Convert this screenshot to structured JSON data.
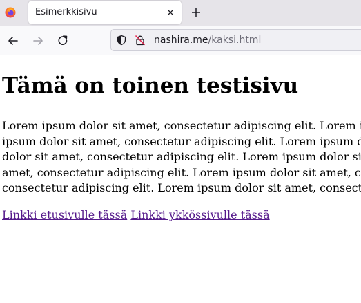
{
  "browser": {
    "tab": {
      "title": "Esimerkkisivu"
    },
    "address": {
      "domain": "nashira.me",
      "path": "/kaksi.html"
    }
  },
  "page": {
    "heading": "Tämä on toinen testisivu",
    "paragraph_lines": [
      "Lorem ipsum dolor sit amet, consectetur adipiscing elit. Lorem ipsum",
      "ipsum dolor sit amet, consectetur adipiscing elit. Lorem ipsum dolor",
      "dolor sit amet, consectetur adipiscing elit. Lorem ipsum dolor sit ame",
      "amet, consectetur adipiscing elit. Lorem ipsum dolor sit amet, consec",
      "consectetur adipiscing elit. Lorem ipsum dolor sit amet, consectetur"
    ],
    "links": [
      {
        "label": "Linkki etusivulle tässä"
      },
      {
        "label": "Linkki ykkössivulle tässä"
      }
    ]
  },
  "colors": {
    "link_visited": "#551a8b",
    "toolbar": "#f9f9fb",
    "tabstrip": "#e6e4e9"
  }
}
